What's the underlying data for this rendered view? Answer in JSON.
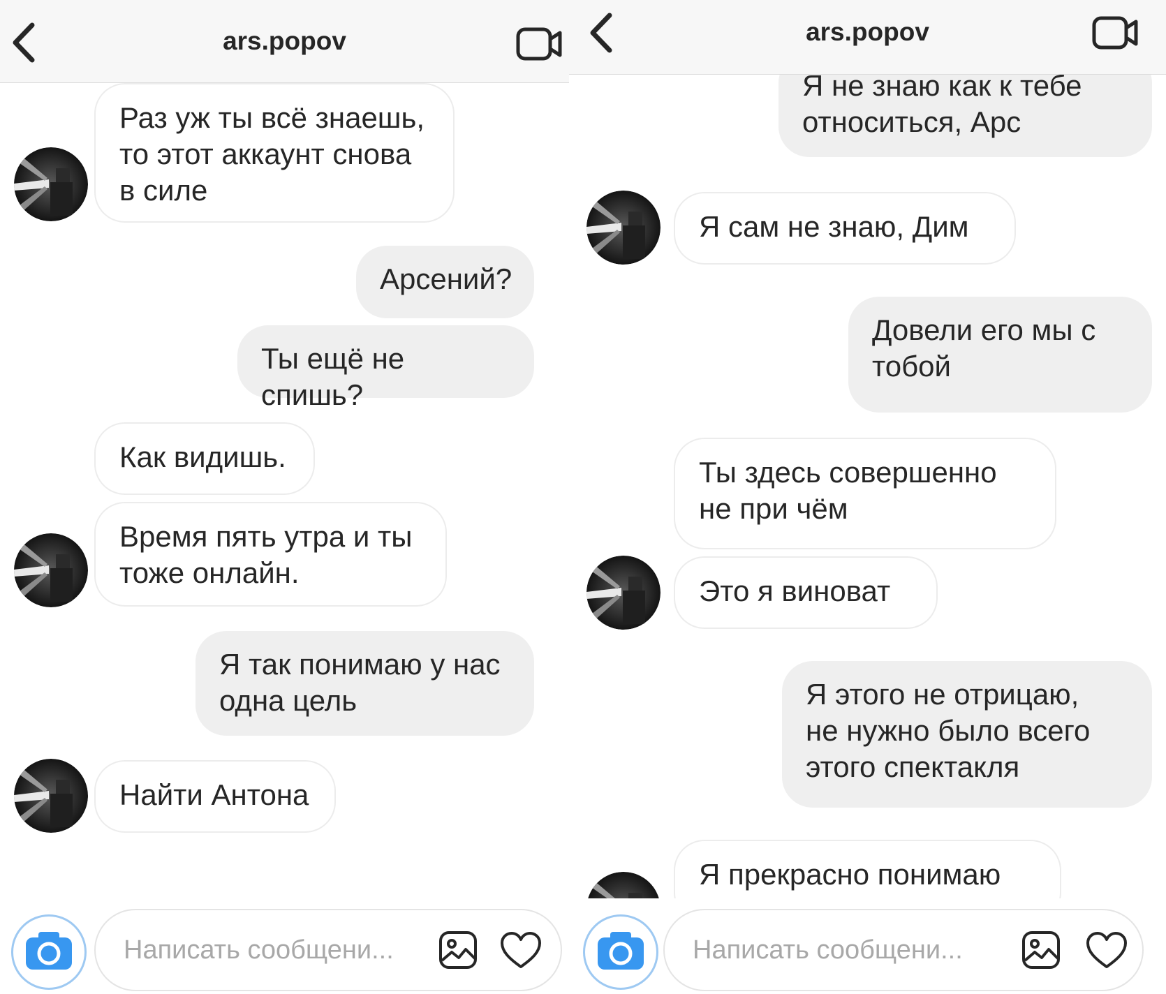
{
  "left": {
    "header": {
      "title": "ars.popov"
    },
    "messages": [
      "Раз уж ты всё знаешь,\nто этот аккаунт снова\nв силе",
      "Арсений?",
      "Ты ещё не спишь?",
      "Как видишь.",
      "Время пять утра и ты\nтоже онлайн.",
      "Я так понимаю у нас\nодна цель",
      "Найти Антона"
    ],
    "composer": {
      "placeholder": "Написать сообщени..."
    }
  },
  "right": {
    "header": {
      "title": "ars.popov"
    },
    "messages": [
      "Я не знаю как к тебе\nотноситься, Арс",
      "Я сам не знаю, Дим",
      "Довели его мы с\nтобой",
      "Ты здесь совершенно\nне при чём",
      "Это я виноват",
      "Я этого не отрицаю,\nне нужно было всего\nэтого спектакля",
      "Я прекрасно понимаю"
    ],
    "composer": {
      "placeholder": "Написать сообщени..."
    }
  },
  "colors": {
    "incoming_bubble": "#ffffff",
    "outgoing_bubble": "#efefef",
    "camera_button": "#3897f0",
    "placeholder_text": "#a8a8a8"
  },
  "icons": [
    "back-chevron-icon",
    "video-call-icon",
    "camera-icon",
    "gallery-icon",
    "heart-icon"
  ]
}
